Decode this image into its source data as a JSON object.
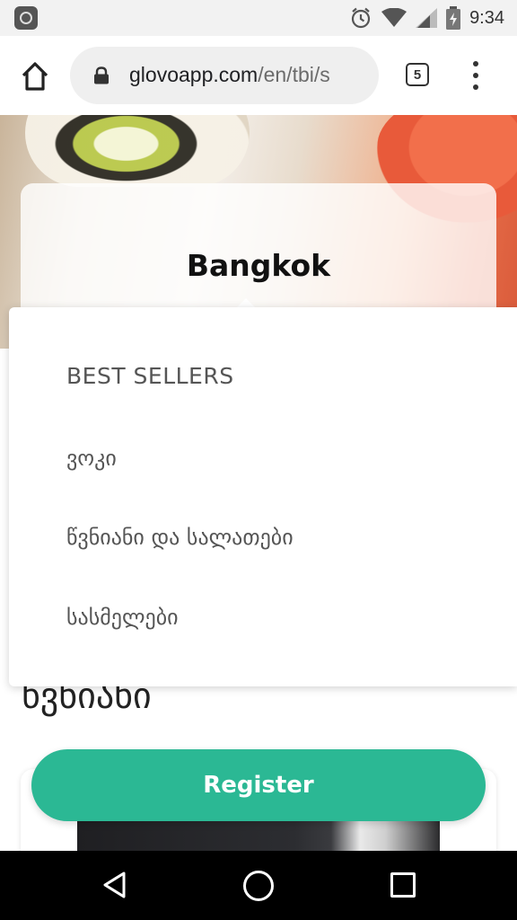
{
  "status_bar": {
    "time": "9:34",
    "icons": [
      "mi-icon",
      "alarm-icon",
      "wifi-icon",
      "signal-icon",
      "battery-icon"
    ]
  },
  "browser": {
    "url_domain": "glovoapp.com",
    "url_path": "/en/tbi/s",
    "tab_count": "5",
    "icons": [
      "home-icon",
      "lock-icon",
      "tabs-icon",
      "more-vert-icon"
    ]
  },
  "store": {
    "name": "Bangkok"
  },
  "category_menu": {
    "items": [
      "BEST SELLERS",
      "ვოკი",
      "წვნიანი და სალათები",
      "სასმელები"
    ]
  },
  "main": {
    "section_heading": "წვნიანი"
  },
  "cta": {
    "register_label": "Register",
    "color": "#2bb894"
  },
  "nav_bar": {
    "icons": [
      "back-icon",
      "home-circle-icon",
      "recents-icon"
    ]
  }
}
